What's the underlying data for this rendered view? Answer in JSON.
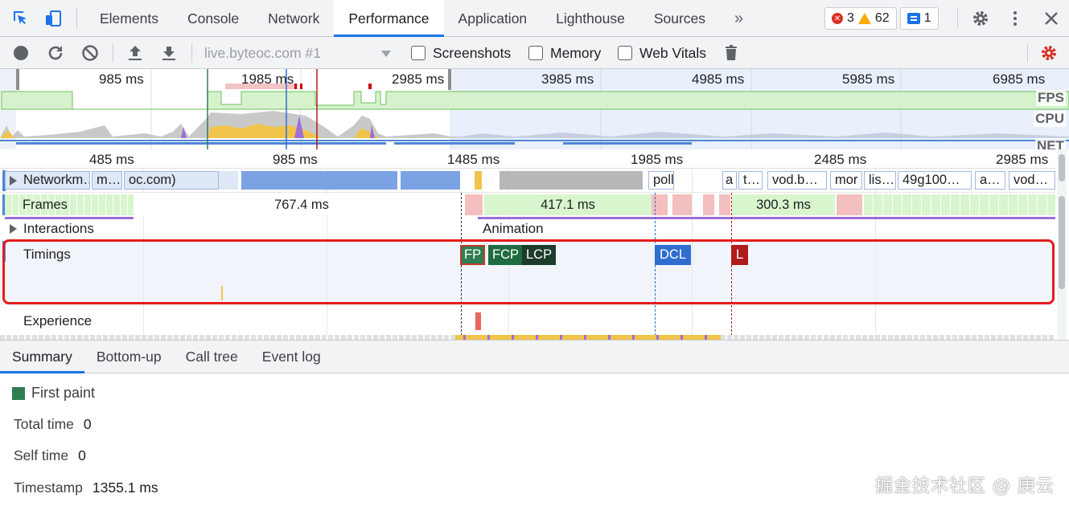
{
  "topbar": {
    "tabs": [
      "Elements",
      "Console",
      "Network",
      "Performance",
      "Application",
      "Lighthouse",
      "Sources"
    ],
    "active_tab": "Performance",
    "more_tabs": "»",
    "errors": "3",
    "warnings": "62",
    "messages": "1"
  },
  "toolbar": {
    "profile": "live.byteoc.com #1",
    "screenshots_label": "Screenshots",
    "memory_label": "Memory",
    "web_vitals_label": "Web Vitals"
  },
  "overview": {
    "ticks": [
      "985 ms",
      "1985 ms",
      "2985 ms",
      "3985 ms",
      "4985 ms",
      "5985 ms",
      "6985 ms"
    ],
    "fps_label": "FPS",
    "cpu_label": "CPU",
    "net_label": "NET"
  },
  "ruler": {
    "ticks": [
      "485 ms",
      "985 ms",
      "1485 ms",
      "1985 ms",
      "2485 ms",
      "2985 ms"
    ]
  },
  "tracks": {
    "network_label": "Network",
    "network_items": [
      "m…",
      "m…",
      "oc.com)",
      "poll",
      "a",
      "t…",
      "vod.b…",
      "mor",
      "lis…",
      "49g100…",
      "a…",
      "vod…"
    ],
    "frames_label": "Frames",
    "frames": [
      "767.4 ms",
      "417.1 ms",
      "300.3 ms"
    ],
    "interactions_label": "Interactions",
    "animation_label": "Animation",
    "timings_label": "Timings",
    "timings": [
      "FP",
      "FCP",
      "LCP",
      "DCL",
      "L"
    ],
    "experience_label": "Experience",
    "colors": {
      "fp": "#2f7d52",
      "fcp": "#1f6b3f",
      "lcp": "#1d3b2a",
      "dcl": "#2f6ecf",
      "l": "#b01c1c",
      "highlight": "#e51d1d"
    }
  },
  "bottom": {
    "tabs": [
      "Summary",
      "Bottom-up",
      "Call tree",
      "Event log"
    ],
    "active_tab": "Summary",
    "title": "First paint",
    "rows": [
      {
        "label": "Total time",
        "value": "0"
      },
      {
        "label": "Self time",
        "value": "0"
      },
      {
        "label": "Timestamp",
        "value": "1355.1 ms"
      }
    ]
  },
  "watermark": "掘金技术社区 @ 庚云"
}
